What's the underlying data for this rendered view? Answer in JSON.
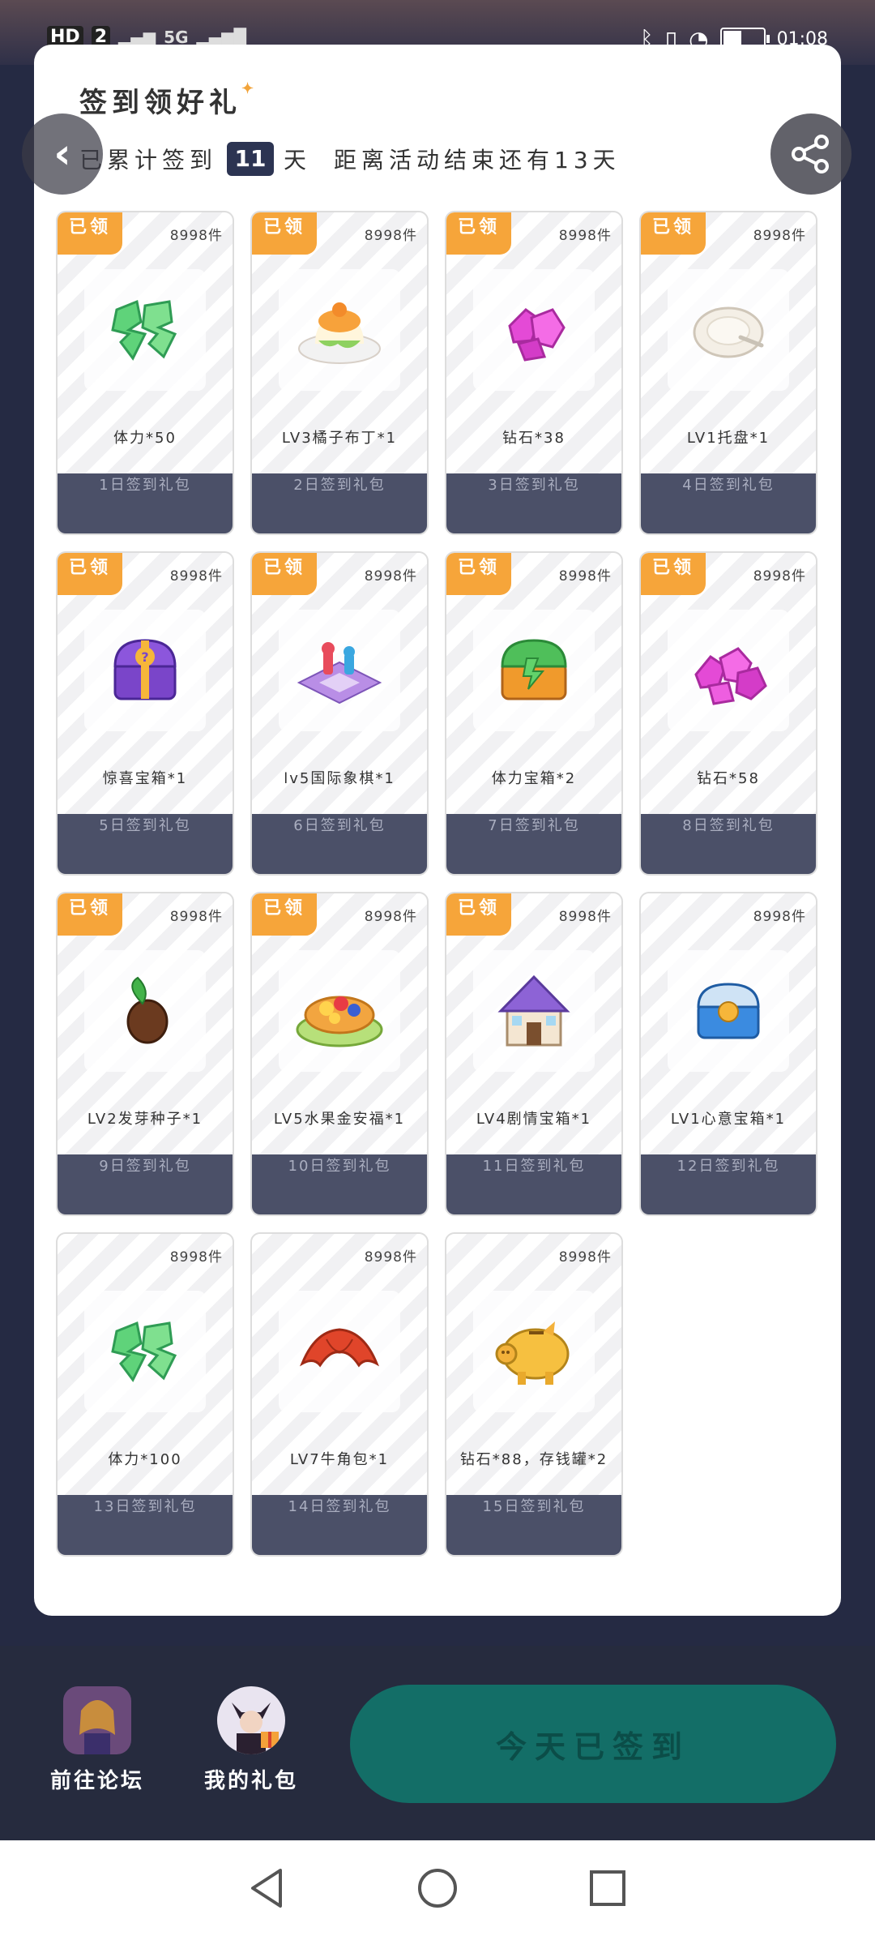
{
  "status_bar": {
    "badges": [
      "HD",
      "2"
    ],
    "signal": "5G",
    "time": "01:08",
    "battery_level": 0.5
  },
  "header": {
    "title": "签到领好礼",
    "subtitle_prefix": "已累计签到",
    "days_signed": "11",
    "subtitle_days_unit": "天",
    "subtitle_remaining": "距离活动结束还有13天"
  },
  "gifts": [
    {
      "claimed": true,
      "claimed_label": "已领",
      "stock": "8998件",
      "name": "体力*50",
      "day_label": "1日签到礼包",
      "icon": "stamina-icon"
    },
    {
      "claimed": true,
      "claimed_label": "已领",
      "stock": "8998件",
      "name": "LV3橘子布丁*1",
      "day_label": "2日签到礼包",
      "icon": "pudding-icon"
    },
    {
      "claimed": true,
      "claimed_label": "已领",
      "stock": "8998件",
      "name": "钻石*38",
      "day_label": "3日签到礼包",
      "icon": "diamond-icon"
    },
    {
      "claimed": true,
      "claimed_label": "已领",
      "stock": "8998件",
      "name": "LV1托盘*1",
      "day_label": "4日签到礼包",
      "icon": "plate-icon"
    },
    {
      "claimed": true,
      "claimed_label": "已领",
      "stock": "8998件",
      "name": "惊喜宝箱*1",
      "day_label": "5日签到礼包",
      "icon": "surprise-chest-icon"
    },
    {
      "claimed": true,
      "claimed_label": "已领",
      "stock": "8998件",
      "name": "lv5国际象棋*1",
      "day_label": "6日签到礼包",
      "icon": "chess-icon"
    },
    {
      "claimed": true,
      "claimed_label": "已领",
      "stock": "8998件",
      "name": "体力宝箱*2",
      "day_label": "7日签到礼包",
      "icon": "stamina-chest-icon"
    },
    {
      "claimed": true,
      "claimed_label": "已领",
      "stock": "8998件",
      "name": "钻石*58",
      "day_label": "8日签到礼包",
      "icon": "diamond-pile-icon"
    },
    {
      "claimed": true,
      "claimed_label": "已领",
      "stock": "8998件",
      "name": "LV2发芽种子*1",
      "day_label": "9日签到礼包",
      "icon": "seed-icon"
    },
    {
      "claimed": true,
      "claimed_label": "已领",
      "stock": "8998件",
      "name": "LV5水果金安福*1",
      "day_label": "10日签到礼包",
      "icon": "fruit-tart-icon"
    },
    {
      "claimed": true,
      "claimed_label": "已领",
      "stock": "8998件",
      "name": "LV4剧情宝箱*1",
      "day_label": "11日签到礼包",
      "icon": "house-icon"
    },
    {
      "claimed": false,
      "claimed_label": "",
      "stock": "8998件",
      "name": "LV1心意宝箱*1",
      "day_label": "12日签到礼包",
      "icon": "blue-chest-icon"
    },
    {
      "claimed": false,
      "claimed_label": "",
      "stock": "8998件",
      "name": "体力*100",
      "day_label": "13日签到礼包",
      "icon": "stamina-icon"
    },
    {
      "claimed": false,
      "claimed_label": "",
      "stock": "8998件",
      "name": "LV7牛角包*1",
      "day_label": "14日签到礼包",
      "icon": "croissant-icon"
    },
    {
      "claimed": false,
      "claimed_label": "",
      "stock": "8998件",
      "name": "钻石*88，存钱罐*2",
      "day_label": "15日签到礼包",
      "icon": "piggy-bank-icon"
    }
  ],
  "bottom_bar": {
    "forum_label": "前往论坛",
    "gifts_label": "我的礼包",
    "signed_button": "今天已签到"
  },
  "colors": {
    "accent_orange": "#f6a53a",
    "dark_navy": "#2c3452",
    "day_label_bg": "#4b5068",
    "button_teal": "#136e67"
  }
}
